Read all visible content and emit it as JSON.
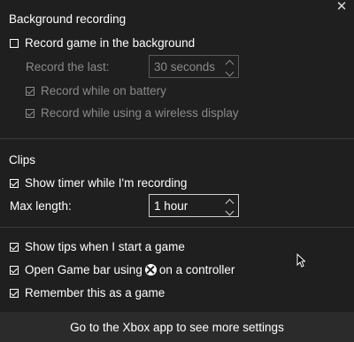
{
  "close_glyph": "✕",
  "background_recording": {
    "title": "Background recording",
    "record_in_background": {
      "label": "Record game in the background",
      "checked": false
    },
    "record_last_label": "Record the last:",
    "record_last_value": "30 seconds",
    "record_on_battery": {
      "label": "Record while on battery",
      "checked": true
    },
    "record_wireless": {
      "label": "Record while using a wireless display",
      "checked": true
    }
  },
  "clips": {
    "title": "Clips",
    "show_timer": {
      "label": "Show timer while I'm recording",
      "checked": true
    },
    "max_length_label": "Max length:",
    "max_length_value": "1 hour"
  },
  "general": {
    "show_tips": {
      "label": "Show tips when I start a game",
      "checked": true
    },
    "open_game_bar": {
      "label_before": "Open Game bar using",
      "label_after": "on a controller",
      "checked": true
    },
    "remember_game": {
      "label": "Remember this as a game",
      "checked": true
    }
  },
  "footer": {
    "label": "Go to the Xbox app to see more settings"
  }
}
